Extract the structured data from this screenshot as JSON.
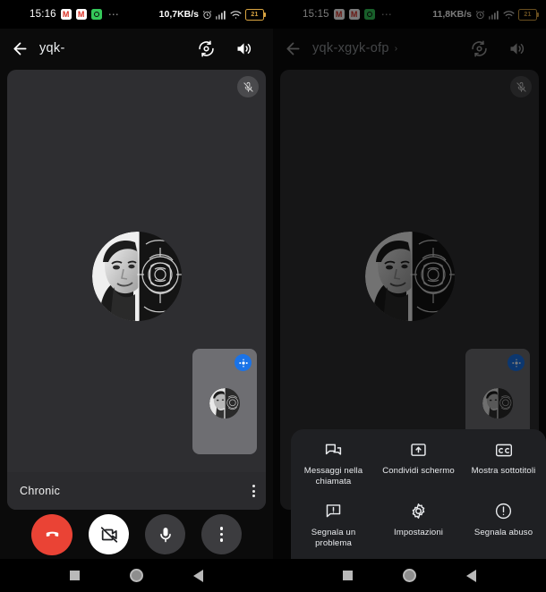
{
  "left": {
    "status_bar": {
      "time": "15:16",
      "net_speed": "10,7KB/s",
      "battery_level": "21",
      "overflow_dots": "…",
      "icons": [
        "gmail-icon",
        "gmail-icon",
        "whatsapp-icon",
        "alarm-icon",
        "signal-icon",
        "wifi-icon",
        "battery-icon"
      ]
    },
    "header": {
      "title": "yqk-",
      "back_icon": "arrow-back-icon",
      "switch_camera_icon": "switch-camera-icon",
      "speaker_icon": "speaker-icon"
    },
    "video": {
      "mute_badge_icon": "mic-off-icon",
      "avatar_name": "participant-avatar"
    },
    "pip": {
      "effects_badge_icon": "effects-icon",
      "avatar_name": "self-avatar"
    },
    "name_bar": {
      "participant_name": "Chronic",
      "more_icon": "more-vertical-icon"
    },
    "controls": [
      {
        "name": "end-call-button",
        "icon": "call-end-icon",
        "style": "end"
      },
      {
        "name": "camera-toggle-button",
        "icon": "videocam-off-icon",
        "style": "white"
      },
      {
        "name": "microphone-toggle-button",
        "icon": "mic-icon",
        "style": "dark"
      },
      {
        "name": "more-options-button",
        "icon": "more-vertical-icon",
        "style": "dark"
      }
    ],
    "nav_bar": [
      "recents-button",
      "home-button",
      "back-button"
    ]
  },
  "right": {
    "status_bar": {
      "time": "15:15",
      "net_speed": "11,8KB/s",
      "battery_level": "21",
      "overflow_dots": "…"
    },
    "header": {
      "title": "yqk-xgyk-ofp",
      "chevron": "›",
      "back_icon": "arrow-back-icon",
      "switch_camera_icon": "switch-camera-icon",
      "speaker_icon": "speaker-icon"
    },
    "menu": {
      "items": [
        {
          "label": "Messaggi nella chiamata",
          "icon": "chat-bubbles-icon",
          "name": "menu-item-messages"
        },
        {
          "label": "Condividi schermo",
          "icon": "screen-share-icon",
          "name": "menu-item-share-screen"
        },
        {
          "label": "Mostra sottotitoli",
          "icon": "closed-caption-icon",
          "name": "menu-item-captions"
        },
        {
          "label": "Segnala un problema",
          "icon": "feedback-icon",
          "name": "menu-item-report-problem"
        },
        {
          "label": "Impostazioni",
          "icon": "gear-icon",
          "name": "menu-item-settings"
        },
        {
          "label": "Segnala abuso",
          "icon": "report-abuse-icon",
          "name": "menu-item-report-abuse"
        }
      ]
    },
    "nav_bar": [
      "recents-button",
      "home-button",
      "back-button"
    ]
  },
  "colors": {
    "accent_blue": "#1a73e8",
    "end_call_red": "#ea4335",
    "video_bg": "#2e2e31",
    "pip_bg": "#6e6e72",
    "menu_bg": "#1f2023",
    "battery_amber": "#d9a441"
  }
}
